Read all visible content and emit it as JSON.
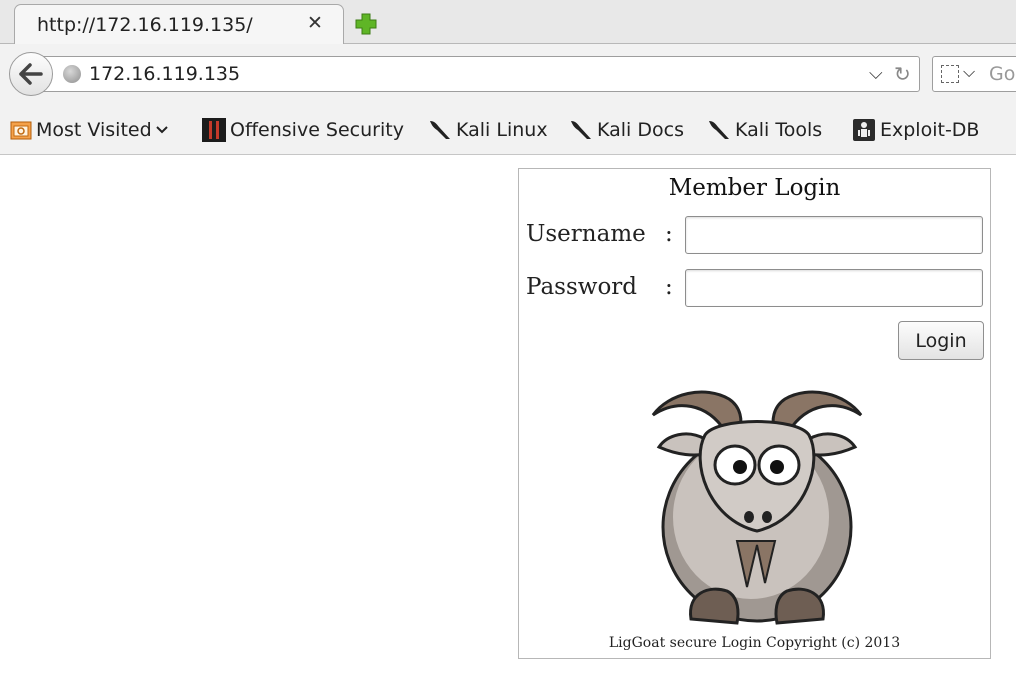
{
  "tab": {
    "title": "http://172.16.119.135/",
    "close_glyph": "✕"
  },
  "navigation": {
    "url": "172.16.119.135",
    "search_placeholder": "Go"
  },
  "bookmarks": [
    {
      "label": "Most Visited",
      "icon": "most-visited-icon"
    },
    {
      "label": "Offensive Security",
      "icon": "offensive-security-icon"
    },
    {
      "label": "Kali Linux",
      "icon": "kali-dragon-icon"
    },
    {
      "label": "Kali Docs",
      "icon": "kali-dragon-icon"
    },
    {
      "label": "Kali Tools",
      "icon": "kali-dragon-icon"
    },
    {
      "label": "Exploit-DB",
      "icon": "exploit-db-icon"
    }
  ],
  "login": {
    "title": "Member Login",
    "username_label": "Username",
    "password_label": "Password",
    "colon": ":",
    "username_value": "",
    "password_value": "",
    "button_label": "Login",
    "copyright": "LigGoat secure Login Copyright (c) 2013"
  },
  "colors": {
    "accent_bookmark_icon": "#e07b1a",
    "new_tab_plus": "#5fb526"
  }
}
